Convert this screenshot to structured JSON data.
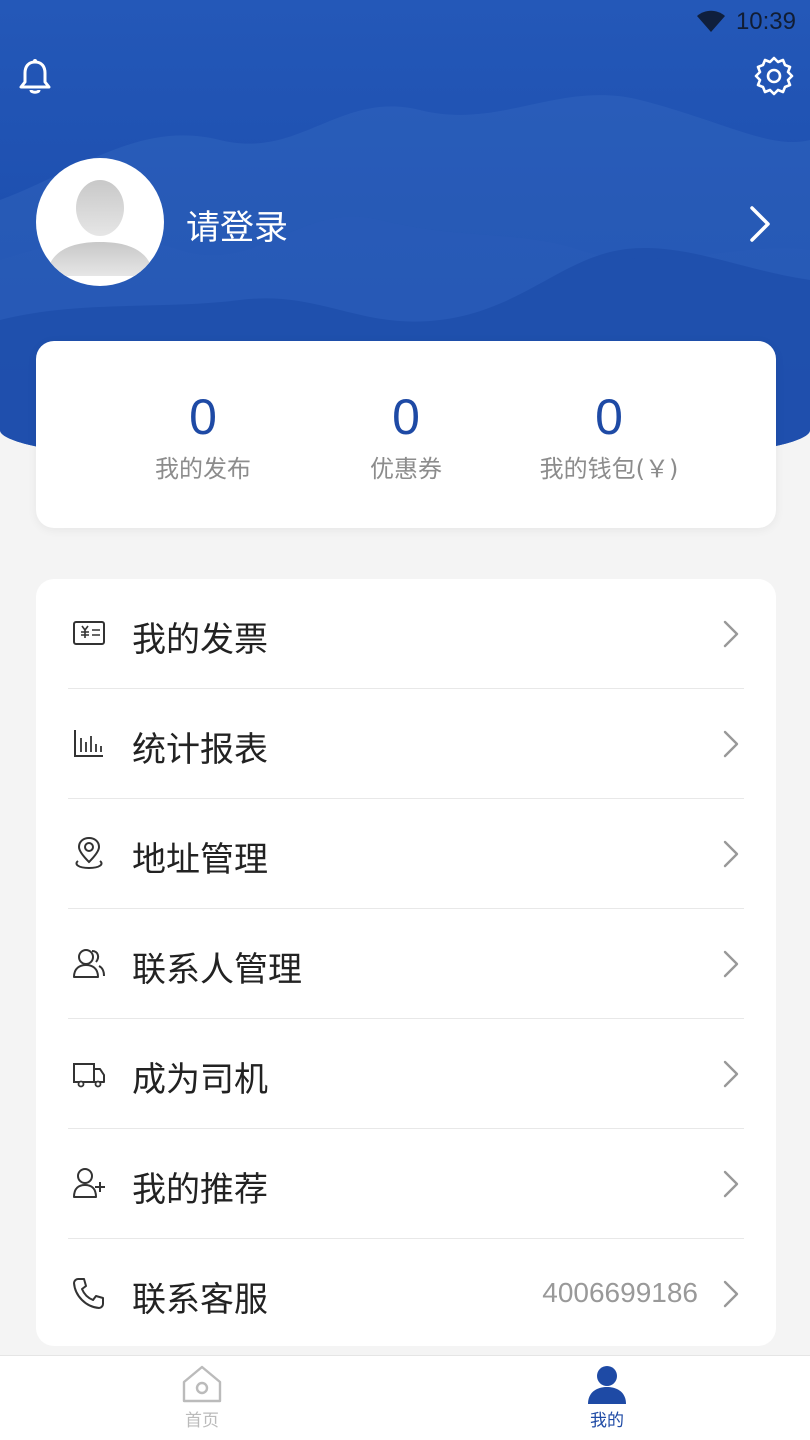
{
  "status": {
    "time": "10:39"
  },
  "header": {
    "login_text": "请登录"
  },
  "stats": [
    {
      "value": "0",
      "label": "我的发布"
    },
    {
      "value": "0",
      "label": "优惠券"
    },
    {
      "value": "0",
      "label": "我的钱包(￥)"
    }
  ],
  "menu": [
    {
      "label": "我的发票",
      "icon": "invoice-icon"
    },
    {
      "label": "统计报表",
      "icon": "chart-icon"
    },
    {
      "label": "地址管理",
      "icon": "location-icon"
    },
    {
      "label": "联系人管理",
      "icon": "contacts-icon"
    },
    {
      "label": "成为司机",
      "icon": "truck-icon"
    },
    {
      "label": "我的推荐",
      "icon": "add-user-icon"
    },
    {
      "label": "联系客服",
      "icon": "phone-icon",
      "value": "4006699186"
    }
  ],
  "tabs": [
    {
      "label": "首页",
      "active": false
    },
    {
      "label": "我的",
      "active": true
    }
  ],
  "colors": {
    "accent": "#1e4aa5",
    "header_bg": "#1e50b0",
    "tab_inactive": "#bbbbbb"
  }
}
